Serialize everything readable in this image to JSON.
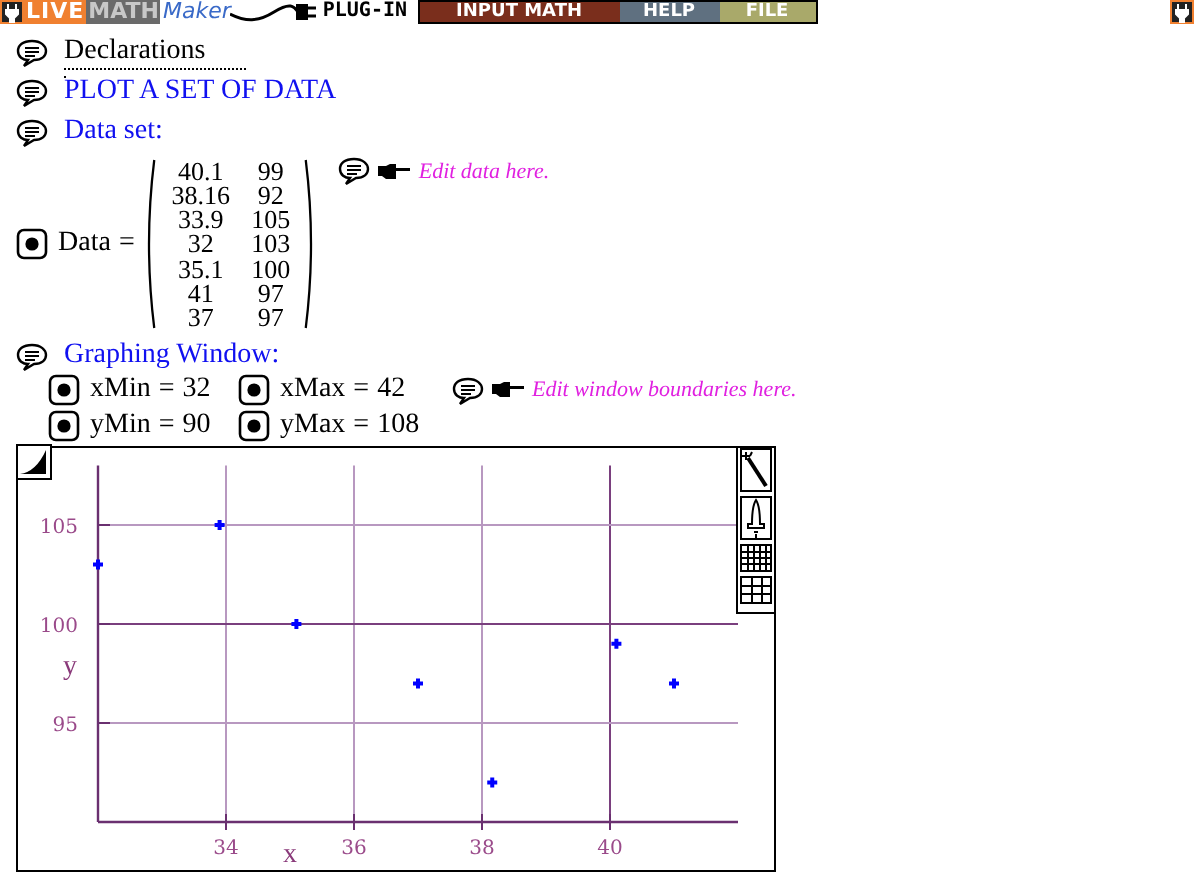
{
  "toolbar": {
    "logo_live": "LIVE",
    "logo_math": "MATH",
    "logo_maker": "Maker",
    "plugin": "PLUG-IN",
    "menus": [
      {
        "label": "INPUT MATH",
        "color": "#7a2e1c"
      },
      {
        "label": "HELP",
        "color": "#5f7080"
      },
      {
        "label": "FILE",
        "color": "#a9a96a"
      }
    ]
  },
  "declarations": "Declarations",
  "title": "PLOT A SET OF DATA",
  "data_set_label": "Data set:",
  "data": {
    "name": "Data",
    "equals": "=",
    "rows": [
      [
        "40.1",
        "99"
      ],
      [
        "38.16",
        "92"
      ],
      [
        "33.9",
        "105"
      ],
      [
        "32",
        "103"
      ],
      [
        "35.1",
        "100"
      ],
      [
        "41",
        "97"
      ],
      [
        "37",
        "97"
      ]
    ]
  },
  "data_hint": "Edit data here.",
  "graphing_label": "Graphing Window:",
  "bounds": [
    [
      {
        "name": "xMin",
        "equals": "=",
        "value": "32"
      },
      {
        "name": "xMax",
        "equals": "=",
        "value": "42"
      }
    ],
    [
      {
        "name": "yMin",
        "equals": "=",
        "value": "90"
      },
      {
        "name": "yMax",
        "equals": "=",
        "value": "108"
      }
    ]
  ],
  "bounds_hint": "Edit window boundaries here.",
  "plot": {
    "chart_data": {
      "type": "scatter",
      "grid": true,
      "xlabel": "x",
      "ylabel": "y",
      "xlim": [
        32,
        42
      ],
      "ylim": [
        90,
        108
      ],
      "xticks": [
        34,
        36,
        38,
        40
      ],
      "yticks": [
        95,
        100,
        105
      ],
      "series": [
        {
          "color": "#0000ff",
          "x": [
            40.1,
            38.16,
            33.9,
            32,
            35.1,
            41,
            37
          ],
          "values": [
            99,
            92,
            105,
            103,
            100,
            97,
            97
          ]
        }
      ]
    }
  }
}
